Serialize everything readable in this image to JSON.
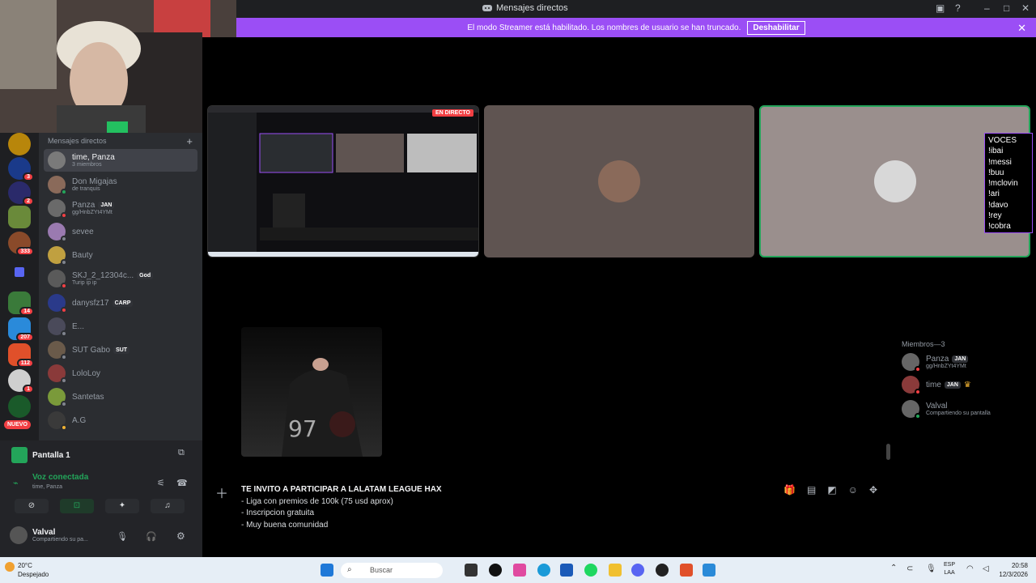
{
  "window": {
    "title": "Mensajes directos"
  },
  "banner": {
    "text": "El modo Streamer está habilitado. Los nombres de usuario se han truncado.",
    "button": "Deshabilitar"
  },
  "servers": {
    "badges": [
      "3",
      "2",
      "333",
      "14",
      "207",
      "112",
      "1"
    ],
    "new_label": "NUEVO"
  },
  "dm": {
    "header": "Mensajes directos",
    "items": [
      {
        "name": "time, Panza",
        "sub": "3 miembros"
      },
      {
        "name": "Don Migajas",
        "sub": "de tranquis"
      },
      {
        "name": "Panza",
        "tag": "JAN",
        "sub": "gg/HnbZYt4YMt"
      },
      {
        "name": "sevee"
      },
      {
        "name": "Bauty"
      },
      {
        "name": "SKJ_2_12304c...",
        "tag": "God",
        "sub": "Turip ip ip"
      },
      {
        "name": "danysfz17",
        "tag": "CARP"
      },
      {
        "name": "E..."
      },
      {
        "name": "SUT Gabo",
        "tag": "SUT"
      },
      {
        "name": "LoloLoy"
      },
      {
        "name": "Santetas"
      },
      {
        "name": "A.G"
      }
    ]
  },
  "voice": {
    "screen_label": "Pantalla 1",
    "status": "Voz conectada",
    "channel": "time, Panza",
    "user": "Valval",
    "user_status": "Compartiendo su pa..."
  },
  "stream": {
    "live_label": "EN DIRECTO",
    "voces": [
      "VOCES",
      "!ibai",
      "!messi",
      "!buu",
      "!mclovin",
      "!ari",
      "!davo",
      "!rey",
      "!cobra"
    ]
  },
  "members": {
    "header": "Miembros—3",
    "items": [
      {
        "name": "Panza",
        "tag": "JAN",
        "sub": "gg/HnbZYt4YMt"
      },
      {
        "name": "time",
        "tag": "JAN",
        "sub": ""
      },
      {
        "name": "Valval",
        "sub": "Compartiendo su pantalla"
      }
    ]
  },
  "composer": {
    "title": "TE INVITO A PARTICIPAR A LALATAM LEAGUE HAX",
    "lines": [
      "- Liga con premios de 100k (75 usd aprox)",
      "- Inscripcion gratuita",
      "- Muy buena comunidad"
    ]
  },
  "taskbar": {
    "weather_temp": "20°C",
    "weather_desc": "Despejado",
    "search": "Buscar",
    "lang1": "ESP",
    "lang2": "LAA",
    "time": "20:58",
    "date": "12/3/2026"
  },
  "colors": {
    "accent": "#9b4ef5",
    "online": "#23a55a",
    "danger": "#f23f43"
  }
}
